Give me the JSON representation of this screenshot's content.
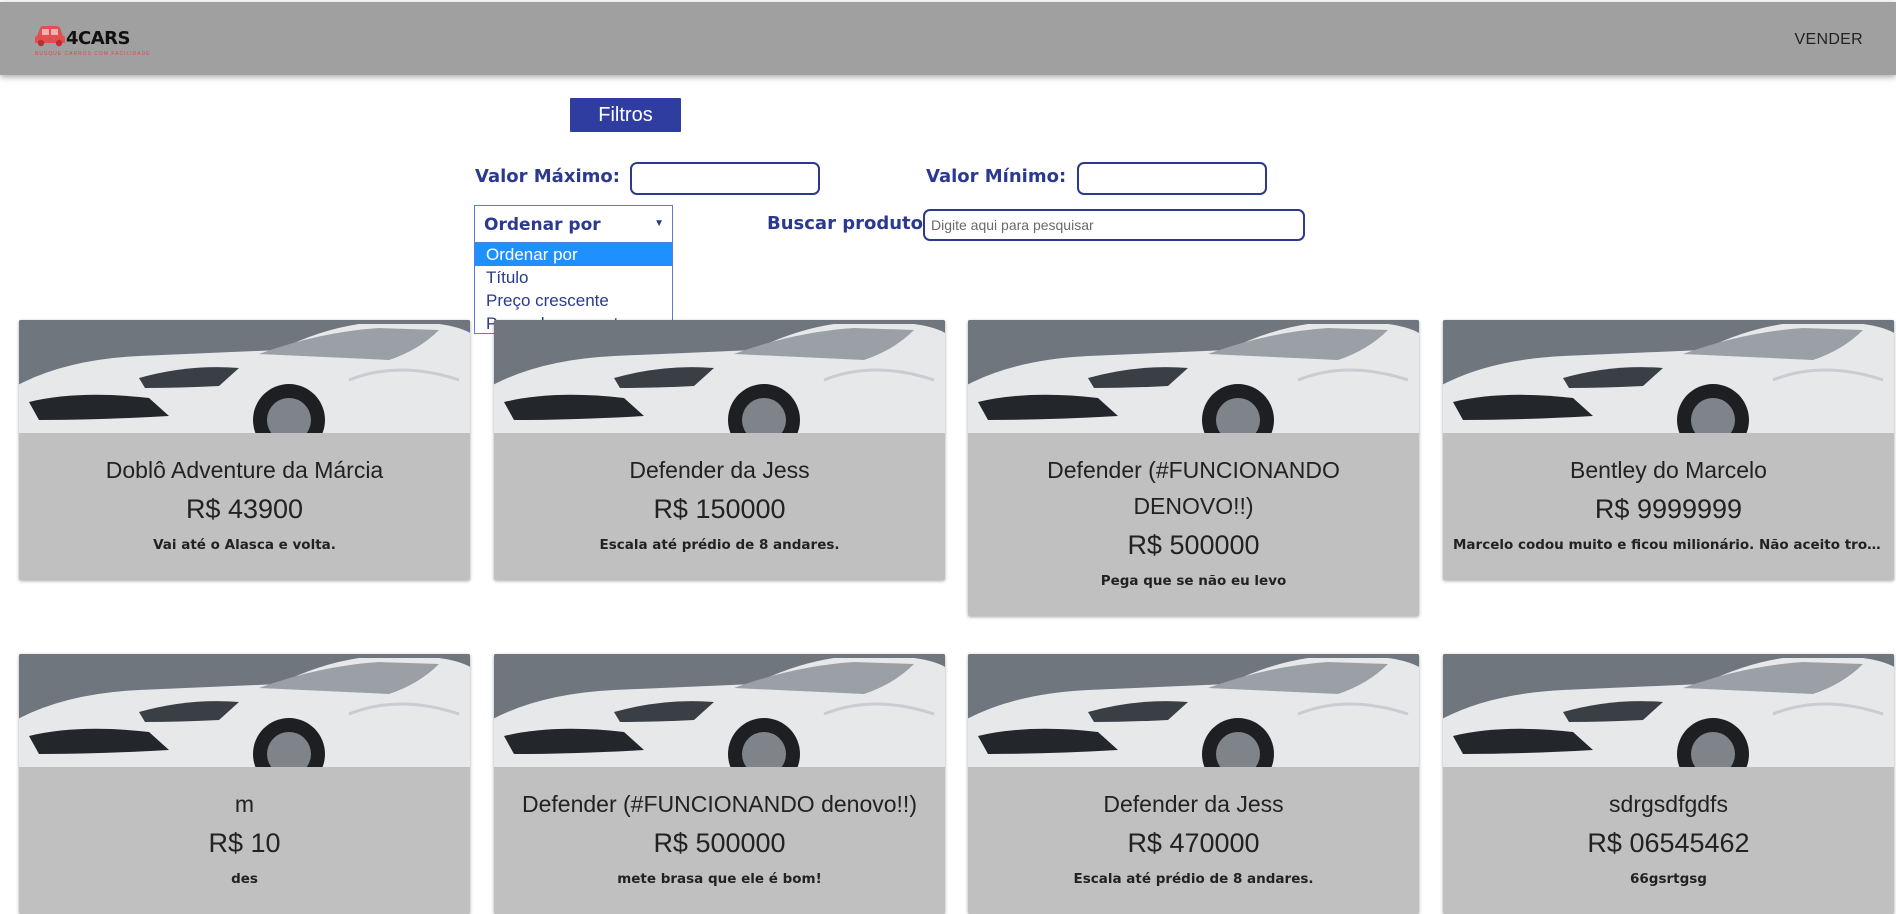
{
  "header": {
    "logo_text": "4CARS",
    "logo_tagline": "BUSQUE CARROS COM FACILIDADE",
    "sell_label": "VENDER"
  },
  "filters": {
    "button_label": "Filtros",
    "max_label": "Valor Máximo:",
    "max_value": "",
    "min_label": "Valor Mínimo:",
    "min_value": "",
    "order_label": "Ordenar por",
    "order_options": [
      "Ordenar por",
      "Título",
      "Preço crescente",
      "Preço decrescente"
    ],
    "highlighted_option": "Ordenar por",
    "search_label": "Buscar produto:",
    "search_placeholder": "Digite aqui para pesquisar",
    "search_value": ""
  },
  "products": [
    {
      "title": "Doblô Adventure da Márcia",
      "price": "R$ 43900",
      "description": "Vai até o Alasca e volta."
    },
    {
      "title": "Defender da Jess",
      "price": "R$ 150000",
      "description": "Escala até prédio de 8 andares."
    },
    {
      "title": "Defender (#FUNCIONANDO DENOVO!!)",
      "price": "R$ 500000",
      "description": "Pega que se não eu levo"
    },
    {
      "title": "Bentley do Marcelo",
      "price": "R$ 9999999",
      "description": "Marcelo codou muito e ficou milionário. Não aceito troca."
    },
    {
      "title": "m",
      "price": "R$ 10",
      "description": "des"
    },
    {
      "title": "Defender (#FUNCIONANDO denovo!!)",
      "price": "R$ 500000",
      "description": "mete brasa que ele é bom!"
    },
    {
      "title": "Defender da Jess",
      "price": "R$ 470000",
      "description": "Escala até prédio de 8 andares."
    },
    {
      "title": "sdrgsdfgdfs",
      "price": "R$ 06545462",
      "description": "66gsrtgsg"
    }
  ],
  "icons": {
    "logo": "car-icon",
    "select_arrow": "chevron-down-icon"
  },
  "colors": {
    "header_bg": "#a0a0a0",
    "accent": "#2f3da0",
    "card_bg": "#c0c0c0",
    "logo_red": "#e05050",
    "option_highlight": "#1e90ff"
  }
}
